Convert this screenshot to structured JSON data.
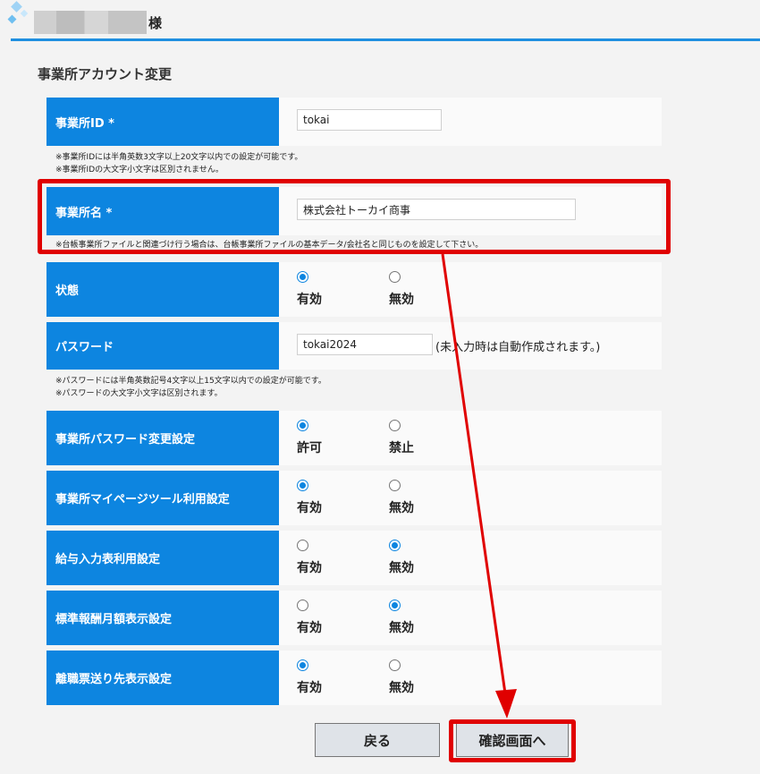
{
  "header": {
    "user_suffix": "様"
  },
  "page_title": "事業所アカウント変更",
  "office_id": {
    "label": "事業所ID *",
    "value": "tokai",
    "notes": [
      "※事業所IDには半角英数3文字以上20文字以内での設定が可能です。",
      "※事業所IDの大文字小文字は区別されません。"
    ]
  },
  "office_name": {
    "label": "事業所名 *",
    "value": "株式会社トーカイ商事",
    "note": "※台帳事業所ファイルと関連づけ行う場合は、台帳事業所ファイルの基本データ/会社名と同じものを設定して下さい。"
  },
  "status": {
    "label": "状態",
    "options": [
      "有効",
      "無効"
    ],
    "selected": "有効"
  },
  "password": {
    "label": "パスワード",
    "value": "tokai2024",
    "hint": "(未入力時は自動作成されます。)",
    "notes": [
      "※パスワードには半角英数記号4文字以上15文字以内での設定が可能です。",
      "※パスワードの大文字小文字は区別されます。"
    ]
  },
  "settings": [
    {
      "label": "事業所パスワード変更設定",
      "options": [
        "許可",
        "禁止"
      ],
      "selected": "許可"
    },
    {
      "label": "事業所マイページツール利用設定",
      "options": [
        "有効",
        "無効"
      ],
      "selected": "有効"
    },
    {
      "label": "給与入力表利用設定",
      "options": [
        "有効",
        "無効"
      ],
      "selected": "無効"
    },
    {
      "label": "標準報酬月額表示設定",
      "options": [
        "有効",
        "無効"
      ],
      "selected": "無効"
    },
    {
      "label": "離職票送り先表示設定",
      "options": [
        "有効",
        "無効"
      ],
      "selected": "有効"
    }
  ],
  "buttons": {
    "back": "戻る",
    "confirm": "確認画面へ"
  },
  "colors": {
    "label_bg": "#0d85e0",
    "highlight": "#e00000",
    "header_line": "#1f8fe0"
  }
}
